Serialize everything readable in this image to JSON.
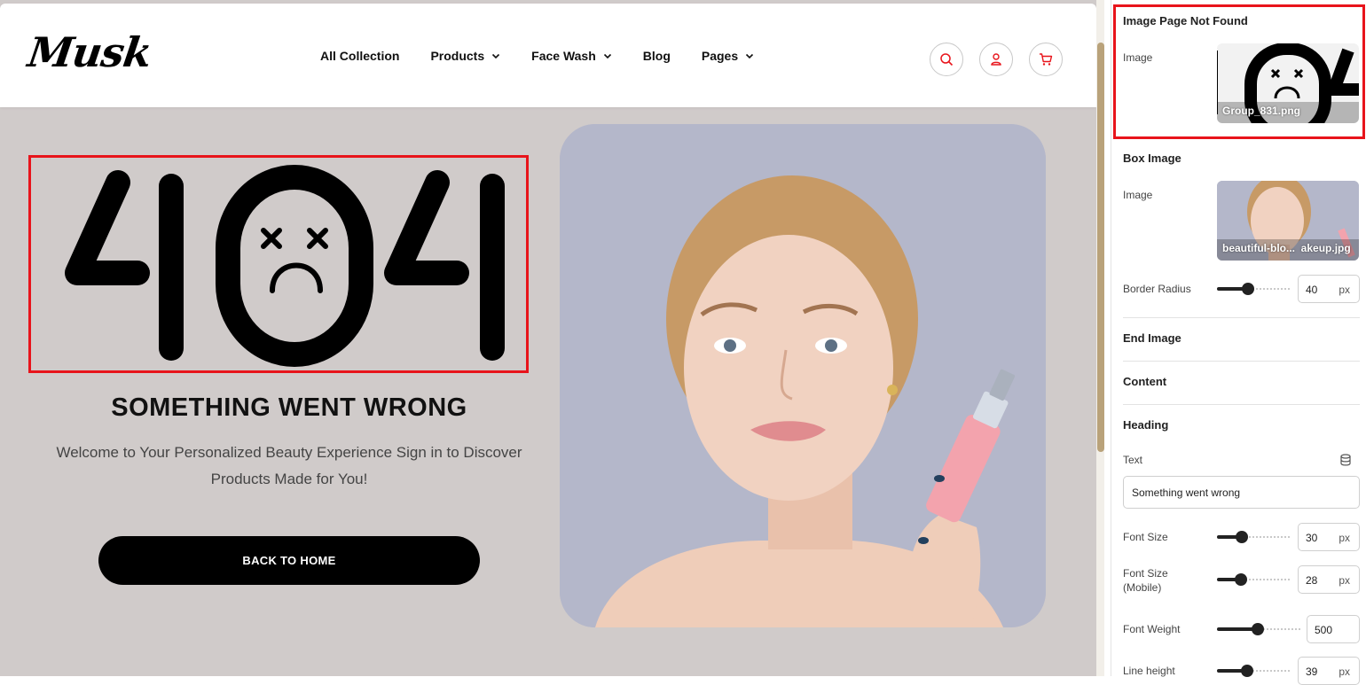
{
  "site": {
    "logo": "Musk",
    "nav": [
      {
        "label": "All Collection",
        "dropdown": false
      },
      {
        "label": "Products",
        "dropdown": true
      },
      {
        "label": "Face Wash",
        "dropdown": true
      },
      {
        "label": "Blog",
        "dropdown": false
      },
      {
        "label": "Pages",
        "dropdown": true
      }
    ],
    "icons": [
      "search-icon",
      "user-icon",
      "cart-icon"
    ],
    "accent_color": "#e8141b"
  },
  "hero": {
    "code": "404",
    "heading": "SOMETHING WENT WRONG",
    "subtext": "Welcome to Your Personalized Beauty Experience Sign in to Discover Products Made for You!",
    "button": "BACK TO HOME"
  },
  "panel": {
    "image_page_not_found": {
      "title": "Image Page Not Found",
      "image_label": "Image",
      "file": "Group_831.png"
    },
    "box_image": {
      "title": "Box Image",
      "image_label": "Image",
      "file_a": "beautiful-blo...",
      "file_b": "akeup.jpg",
      "border_radius_label": "Border Radius",
      "border_radius": "40",
      "border_radius_unit": "px"
    },
    "end_image": {
      "title": "End Image"
    },
    "content": {
      "title": "Content"
    },
    "heading": {
      "title": "Heading",
      "text_label": "Text",
      "text_value": "Something went wrong",
      "font_size_label": "Font Size",
      "font_size": "30",
      "font_size_unit": "px",
      "font_size_mobile_label": "Font Size (Mobile)",
      "font_size_mobile": "28",
      "font_size_mobile_unit": "px",
      "font_weight_label": "Font Weight",
      "font_weight": "500",
      "line_height_label": "Line height",
      "line_height": "39",
      "line_height_unit": "px"
    }
  }
}
